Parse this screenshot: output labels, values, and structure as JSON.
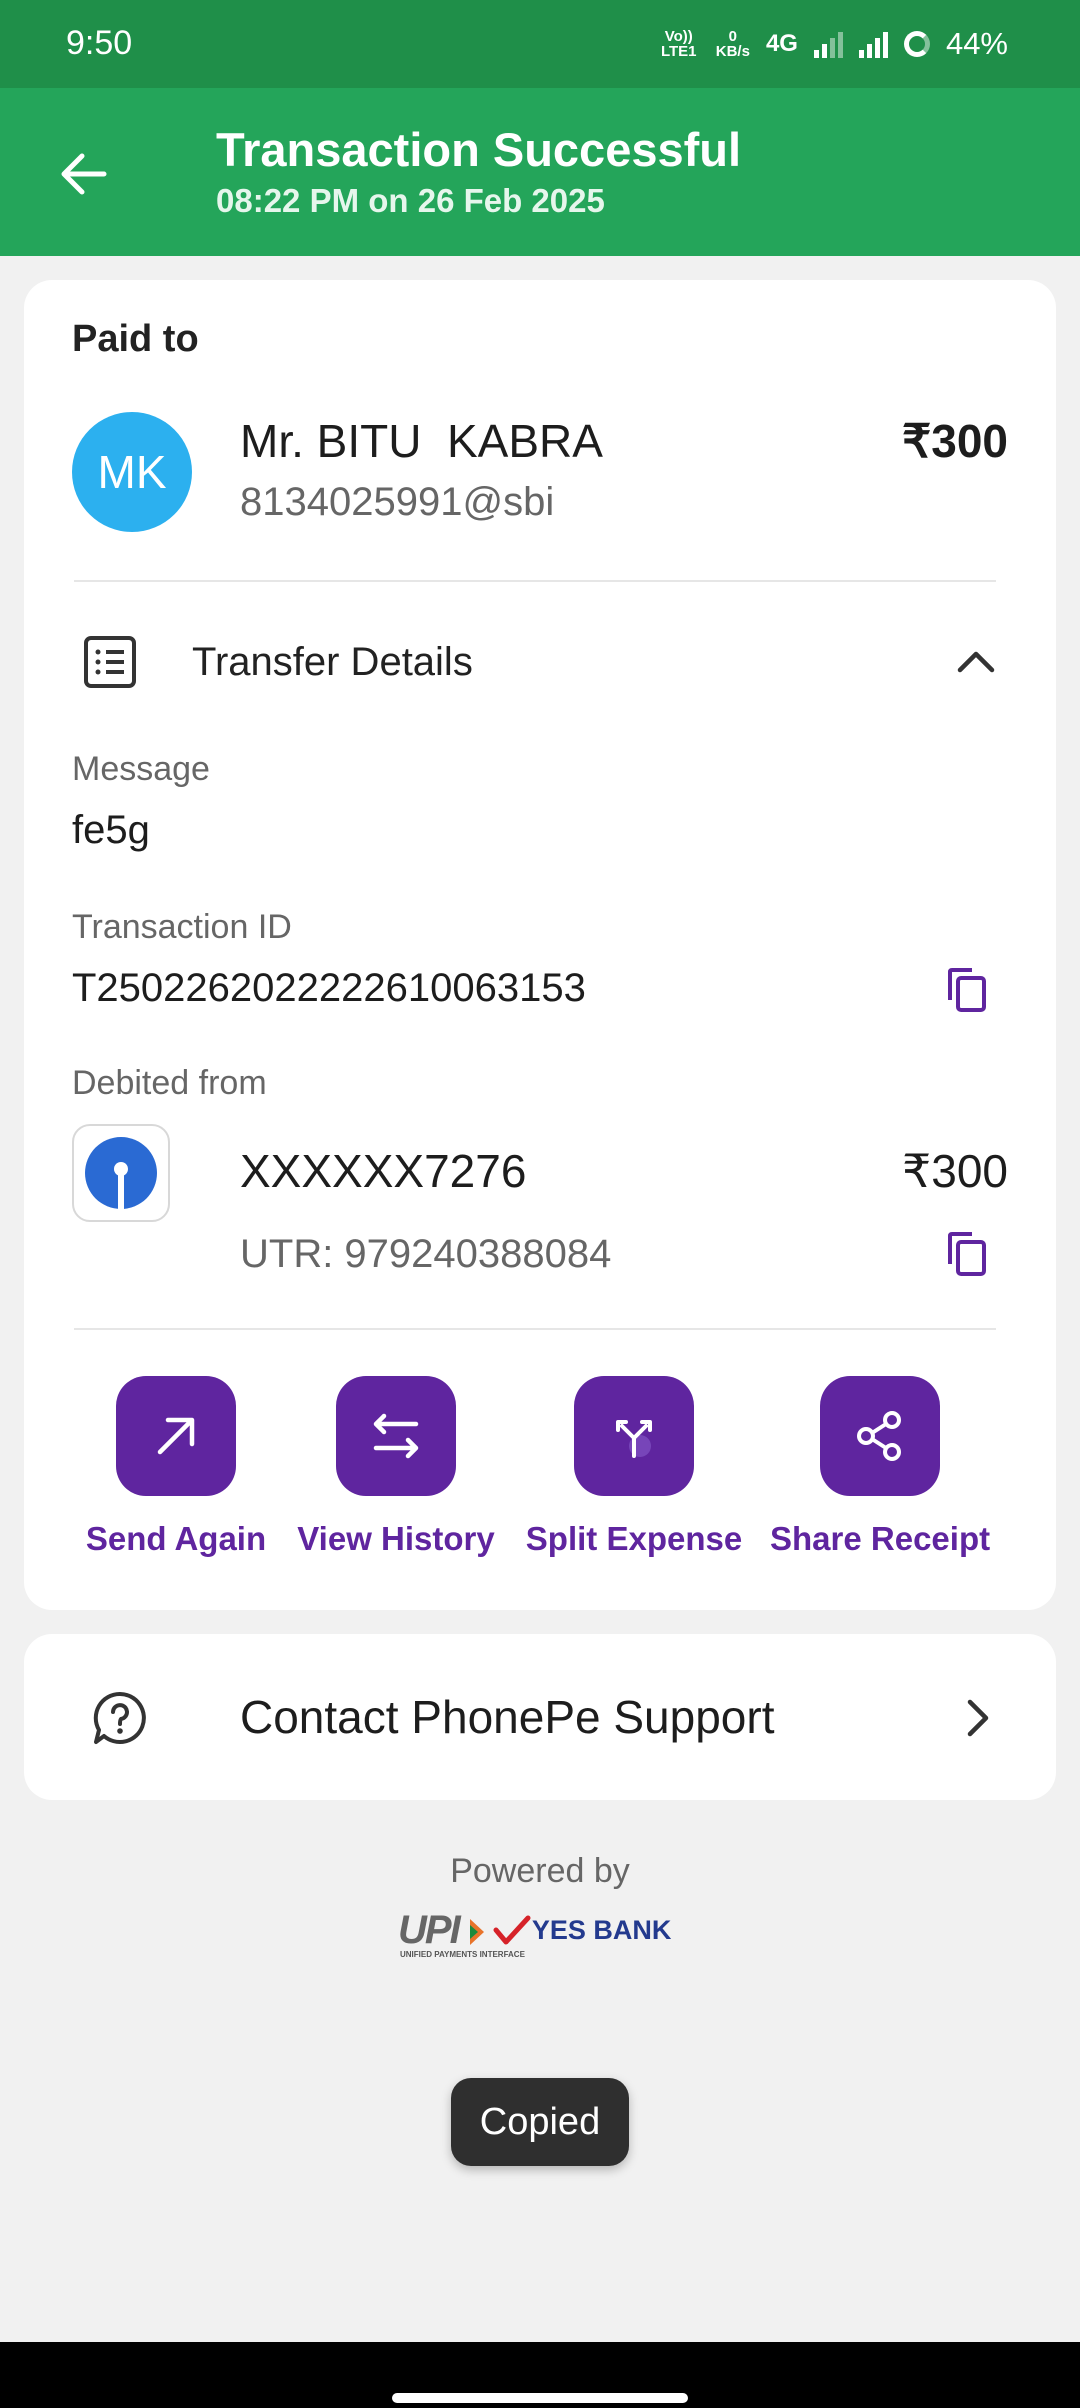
{
  "status_bar": {
    "time": "9:50",
    "volte": "Vo)) LTE1",
    "data_speed_value": "0",
    "data_speed_unit": "KB/s",
    "network": "4G",
    "battery": "44%"
  },
  "header": {
    "title": "Transaction Successful",
    "subtitle": "08:22 PM on 26 Feb 2025",
    "back_icon": "arrow-left-icon",
    "color": "#24a55a"
  },
  "paid_to": {
    "label": "Paid to",
    "avatar_initials": "MK",
    "name": "Mr. BITU  KABRA",
    "upi_id": "8134025991@sbi",
    "amount": "₹300"
  },
  "transfer_details": {
    "label": "Transfer Details",
    "message_label": "Message",
    "message": "fe5g",
    "transaction_id_label": "Transaction ID",
    "transaction_id": "T2502262022222610063153",
    "debited_from_label": "Debited from",
    "account": "XXXXXX7276",
    "account_amount": "₹300",
    "utr": "UTR: 979240388084"
  },
  "actions": [
    {
      "label": "Send Again",
      "icon": "arrow-up-right-icon"
    },
    {
      "label": "View History",
      "icon": "swap-arrows-icon"
    },
    {
      "label": "Split Expense",
      "icon": "split-icon"
    },
    {
      "label": "Share Receipt",
      "icon": "share-icon"
    }
  ],
  "support": {
    "label": "Contact PhonePe Support",
    "icon": "question-chat-icon"
  },
  "footer": {
    "powered_by": "Powered by",
    "upi_logo": "UPI",
    "upi_tagline": "UNIFIED PAYMENTS INTERFACE",
    "bank_logo": "YES BANK"
  },
  "toast": "Copied",
  "accent_color": "#5f259f"
}
